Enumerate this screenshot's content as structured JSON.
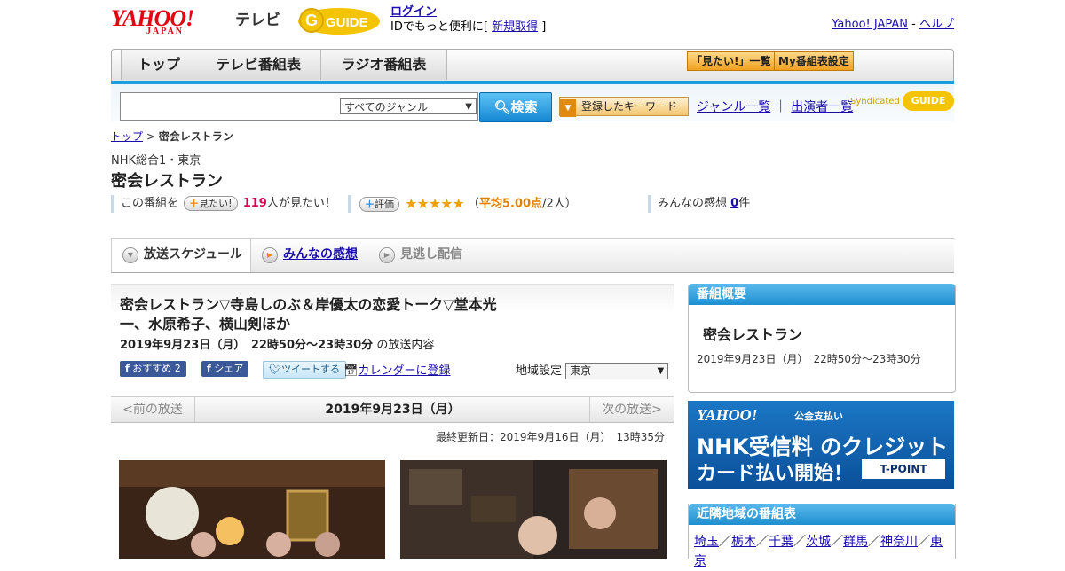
{
  "header": {
    "logo": "YAHOO!",
    "logo_sub": "JAPAN",
    "service": "テレビ",
    "gguide": "GUIDE",
    "login": "ログイン",
    "login_msg": "IDでもっと便利に[",
    "signup": "新規取得",
    "login_msg_end": "]",
    "yahoo_japan": "Yahoo! JAPAN",
    "sep": "-",
    "help": "ヘルプ"
  },
  "nav": {
    "tabs": [
      {
        "label": "トップ"
      },
      {
        "label": "テレビ番組表"
      },
      {
        "label": "ラジオ番組表"
      }
    ],
    "watchlist_btn": "「見たい!」一覧",
    "mylist_btn": "My番組表設定"
  },
  "search": {
    "placeholder": "",
    "genre_select": "すべてのジャンル",
    "search_btn": "検索",
    "keyword_btn": "登録したキーワード",
    "genre_list": "ジャンル一覧",
    "performer_list": "出演者一覧",
    "syndicated": "Syndicated"
  },
  "breadcrumb": {
    "top": "トップ",
    "sep": ">",
    "current": "密会レストラン"
  },
  "program": {
    "station": "NHK総合1・東京",
    "title": "密会レストラン",
    "want_prefix": "この番組を",
    "want_btn": "見たい!",
    "want_count": "119",
    "want_suffix": "人が見たい！",
    "rate_btn": "評価",
    "stars": "★★★★★",
    "rating_open": "（",
    "rating_avg": "平均5.00点",
    "rating_people": "/2人）",
    "impressions_label": "みんなの感想",
    "impressions_count": "0",
    "impressions_unit": "件"
  },
  "tabs": {
    "schedule": "放送スケジュール",
    "impressions": "みんなの感想",
    "vod": "見逃し配信"
  },
  "episode": {
    "title": "密会レストラン▽寺島しのぶ＆岸優太の恋愛トーク▽堂本光一、水原希子、横山剣ほか",
    "datetime": "2019年9月23日（月）　22時50分～23時30分",
    "datetime_suffix": "の放送内容",
    "fb_recommend": "おすすめ 2",
    "fb_share": "シェア",
    "tweet": "ツイートする",
    "calendar": "カレンダーに登録",
    "region_label": "地域設定",
    "region_value": "東京"
  },
  "datenav": {
    "prev": "<前の放送",
    "current": "2019年9月23日（月）",
    "next": "次の放送>"
  },
  "updated": "最終更新日：2019年9月16日（月）　13時35分",
  "sidebar": {
    "overview_head": "番組概要",
    "overview_title": "密会レストラン",
    "overview_time": "2019年9月23日（月）　22時50分～23時30分",
    "banner_logo": "YAHOO!",
    "banner_sub": "公金支払い",
    "banner_line1": "NHK受信料 のクレジット",
    "banner_line2": "カード払い開始！",
    "banner_tpoint": "T-POINT",
    "nearby_head": "近隣地域の番組表",
    "prefectures": [
      "埼玉",
      "栃木",
      "千葉",
      "茨城",
      "群馬",
      "神奈川",
      "東京"
    ],
    "pref_sep": "／"
  },
  "colors": {
    "accent_blue": "#1f9ee0",
    "link": "#1a0dab",
    "yahoo_red": "#e60012",
    "star_orange": "#f0a000"
  }
}
